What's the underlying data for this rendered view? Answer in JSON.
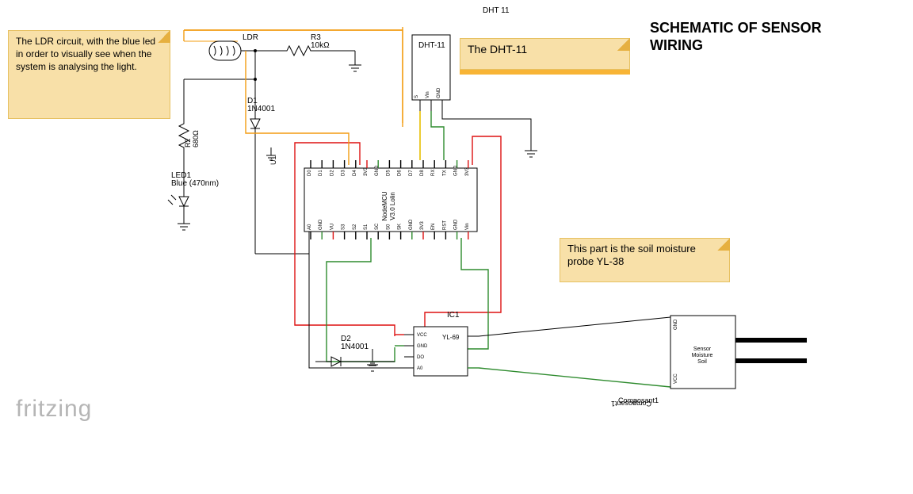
{
  "title_line1": "SCHEMATIC OF SENSOR",
  "title_line2": "WIRING",
  "header_small": "DHT 11",
  "note_ldr": "The LDR circuit, with the blue led in order to visually see when the system is analysing the light.",
  "note_dht": "The DHT-11",
  "note_soil": "This part is the soil moisture probe YL-38",
  "comp": {
    "ldr": "LDR",
    "r3_a": "R3",
    "r3_b": "10kΩ",
    "r2_a": "R2",
    "r2_b": "680Ω",
    "d1_a": "D1",
    "d1_b": "1N4001",
    "d2_a": "D2",
    "d2_b": "1N4001",
    "led_a": "LED1",
    "led_b": "Blue (470nm)",
    "u1": "U1",
    "dht": "DHT-11",
    "dht_box": {
      "p1": "S",
      "p2": "Vin",
      "p3": "GND"
    },
    "mcu_a": "NodeMCU",
    "mcu_b": "V3.0 Lolin",
    "mcu_top": [
      "D0",
      "D1",
      "D2",
      "D3",
      "D4",
      "3V3",
      "GND",
      "D5",
      "D6",
      "D7",
      "D8",
      "RX",
      "TX",
      "GND",
      "3V3"
    ],
    "mcu_bot": [
      "A0",
      "GND",
      "VU",
      "S3",
      "S2",
      "S1",
      "SC",
      "S0",
      "SK",
      "GND",
      "3V3",
      "EN",
      "RST",
      "GND",
      "Vin"
    ],
    "ic1": "IC1",
    "ic1_name": "YL-69",
    "ic1_pins": [
      "VCC",
      "GND",
      "DO",
      "A0"
    ],
    "soil_a": "Sensor",
    "soil_b": "Moisture",
    "soil_c": "Soil",
    "soil_p1": "VCC",
    "soil_p2": "GND",
    "composant": "Composant1"
  },
  "brand": "fritzing"
}
